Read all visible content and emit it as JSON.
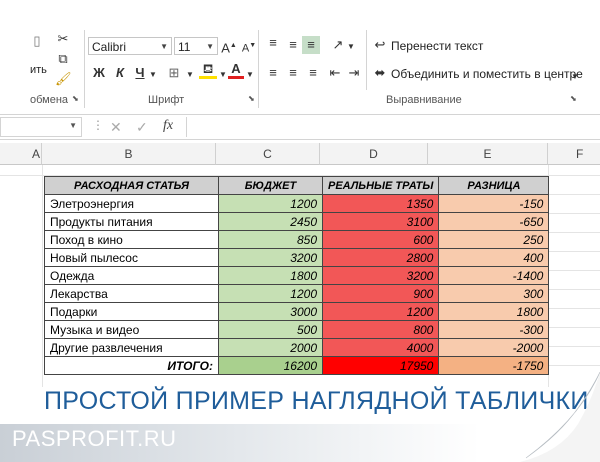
{
  "ribbon": {
    "clipboard_label": "обмена",
    "clipboard_paste_fragment": "ить",
    "font_name": "Calibri",
    "font_size": "11",
    "bold": "Ж",
    "italic": "К",
    "underline": "Ч",
    "font_group_label": "Шрифт",
    "wrap_text": "Перенести текст",
    "merge_center": "Объединить и поместить в центре",
    "alignment_group_label": "Выравнивание",
    "font_color_accent": "#e02020",
    "fill_color_accent": "#ffe000"
  },
  "formula_bar": {
    "name_box": "",
    "fx": "fx",
    "value": ""
  },
  "columns": [
    "A",
    "B",
    "C",
    "D",
    "E",
    "F"
  ],
  "table": {
    "headers": [
      "РАСХОДНАЯ СТАТЬЯ",
      "БЮДЖЕТ",
      "РЕАЛЬНЫЕ ТРАТЫ",
      "РАЗНИЦА"
    ],
    "rows": [
      [
        "Элетроэнергия",
        "1200",
        "1350",
        "-150"
      ],
      [
        "Продукты питания",
        "2450",
        "3100",
        "-650"
      ],
      [
        "Поход в кино",
        "850",
        "600",
        "250"
      ],
      [
        "Новый пылесос",
        "3200",
        "2800",
        "400"
      ],
      [
        "Одежда",
        "1800",
        "3200",
        "-1400"
      ],
      [
        "Лекарства",
        "1200",
        "900",
        "300"
      ],
      [
        "Подарки",
        "3000",
        "1200",
        "1800"
      ],
      [
        "Музыка и видео",
        "500",
        "800",
        "-300"
      ],
      [
        "Другие развлечения",
        "2000",
        "4000",
        "-2000"
      ]
    ],
    "total": [
      "ИТОГО:",
      "16200",
      "17950",
      "-1750"
    ],
    "colors": {
      "budget": "#c6e0b4",
      "budget_total": "#a9d08e",
      "actual": "#f25757",
      "actual_total": "#ff0000",
      "diff": "#f8cbad",
      "diff_total": "#f4b183",
      "header": "#d0d0d0"
    }
  },
  "caption": "ПРОСТОЙ ПРИМЕР НАГЛЯДНОЙ ТАБЛИЧКИ",
  "watermark": "PASPROFIT.RU"
}
